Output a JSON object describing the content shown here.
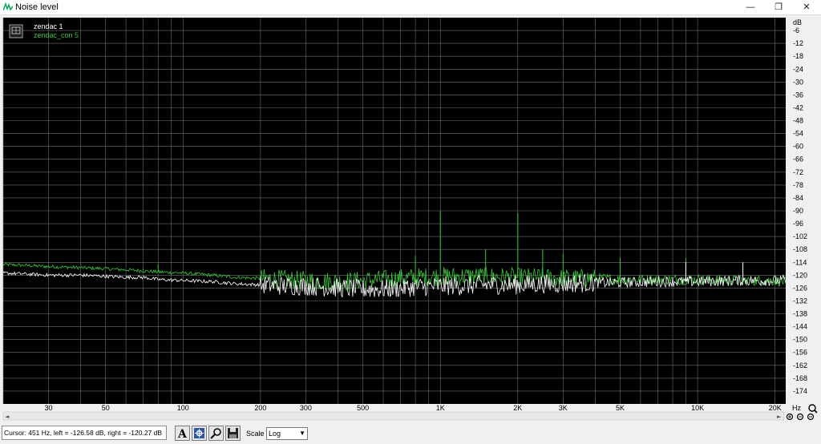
{
  "window": {
    "title": "Noise level",
    "minimize_glyph": "—",
    "maximize_glyph": "❐",
    "close_glyph": "✕"
  },
  "legend": [
    {
      "label": "zendac 1",
      "color": "#ffffff"
    },
    {
      "label": "zendac_con 5",
      "color": "#33cc33"
    }
  ],
  "status": {
    "cursor_text": "Cursor:  451 Hz,  left = -126.58 dB,  right = -120.27 dB",
    "scale_label": "Scale",
    "scale_value": "Log",
    "toolbar_icons": [
      "font-icon",
      "settings-icon",
      "zoom-icon",
      "save-icon"
    ]
  },
  "colors": {
    "plot_bg": "#000000",
    "grid": "#707070",
    "left_channel": "#ffffff",
    "right_channel": "#33cc33"
  },
  "chart_data": {
    "type": "line",
    "x_scale": "log",
    "xlim": [
      20,
      22000
    ],
    "ylim": [
      -180,
      0
    ],
    "x_unit": "Hz",
    "y_unit": "dB",
    "grid": true,
    "legend_position": "top-left",
    "x_ticks": [
      {
        "value": 30,
        "label": "30"
      },
      {
        "value": 50,
        "label": "50"
      },
      {
        "value": 100,
        "label": "100"
      },
      {
        "value": 200,
        "label": "200"
      },
      {
        "value": 300,
        "label": "300"
      },
      {
        "value": 500,
        "label": "500"
      },
      {
        "value": 1000,
        "label": "1K"
      },
      {
        "value": 2000,
        "label": "2K"
      },
      {
        "value": 3000,
        "label": "3K"
      },
      {
        "value": 5000,
        "label": "5K"
      },
      {
        "value": 10000,
        "label": "10K"
      },
      {
        "value": 20000,
        "label": "20K"
      }
    ],
    "y_ticks": [
      -6,
      -12,
      -18,
      -24,
      -30,
      -36,
      -42,
      -48,
      -54,
      -60,
      -66,
      -72,
      -78,
      -84,
      -90,
      -96,
      -102,
      -108,
      -114,
      -120,
      -126,
      -132,
      -138,
      -144,
      -150,
      -156,
      -162,
      -168,
      -174
    ],
    "series": [
      {
        "name": "zendac 1",
        "color": "#ffffff",
        "x": [
          20,
          25,
          30,
          40,
          50,
          60,
          70,
          80,
          100,
          130,
          160,
          200,
          250,
          300,
          400,
          500,
          600,
          700,
          800,
          1000,
          1200,
          1500,
          2000,
          2500,
          3000,
          4000,
          5000,
          7000,
          10000,
          15000,
          20000,
          22000
        ],
        "y": [
          -119,
          -119.5,
          -120,
          -120,
          -120.5,
          -121,
          -121,
          -122,
          -122.5,
          -123,
          -124,
          -124.5,
          -125,
          -125,
          -126,
          -126.5,
          -126.5,
          -126,
          -125.5,
          -125,
          -125,
          -124.5,
          -124.5,
          -124,
          -124,
          -123.5,
          -123.5,
          -123,
          -123,
          -122.5,
          -122.5,
          -122.5
        ]
      },
      {
        "name": "zendac_con 5",
        "color": "#33cc33",
        "x": [
          20,
          25,
          30,
          40,
          50,
          60,
          70,
          80,
          100,
          130,
          160,
          200,
          250,
          300,
          400,
          500,
          600,
          700,
          800,
          1000,
          1200,
          1500,
          2000,
          2500,
          3000,
          4000,
          5000,
          7000,
          10000,
          15000,
          20000,
          22000
        ],
        "y": [
          -115,
          -115.5,
          -116,
          -116.5,
          -117,
          -117.5,
          -118,
          -118.5,
          -119,
          -120,
          -121,
          -121.5,
          -122,
          -122.5,
          -123,
          -122.5,
          -122,
          -121.5,
          -121,
          -120.5,
          -120.5,
          -120.5,
          -121,
          -121,
          -121.5,
          -121.5,
          -122,
          -122,
          -122,
          -122.5,
          -122.5,
          -123
        ]
      }
    ],
    "peaks": [
      {
        "series": 1,
        "x": 1000,
        "y": -90
      },
      {
        "series": 1,
        "x": 1500,
        "y": -108
      },
      {
        "series": 1,
        "x": 2000,
        "y": -91
      },
      {
        "series": 1,
        "x": 2500,
        "y": -108
      },
      {
        "series": 1,
        "x": 3000,
        "y": -110
      },
      {
        "series": 1,
        "x": 800,
        "y": -111
      },
      {
        "series": 1,
        "x": 5000,
        "y": -112
      },
      {
        "series": 1,
        "x": 9000,
        "y": -112
      },
      {
        "series": 1,
        "x": 80,
        "y": -115
      },
      {
        "series": 1,
        "x": 70,
        "y": -117
      },
      {
        "series": 0,
        "x": 9000,
        "y": -114
      },
      {
        "series": 0,
        "x": 15000,
        "y": -114
      }
    ]
  }
}
